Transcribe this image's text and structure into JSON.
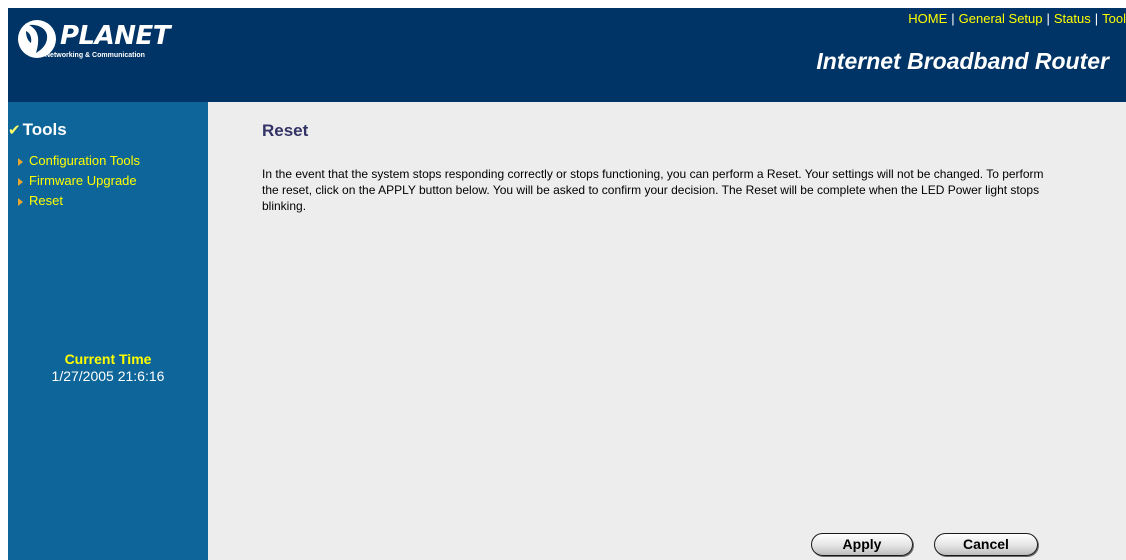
{
  "header": {
    "logo_text": "PLANET",
    "logo_tagline": "Networking & Communication",
    "nav": [
      "HOME",
      "General Setup",
      "Status",
      "Tool"
    ],
    "nav_separator": "|",
    "product_title": "Internet Broadband Router"
  },
  "sidebar": {
    "section_title": "Tools",
    "items": [
      {
        "label": "Configuration Tools"
      },
      {
        "label": "Firmware Upgrade"
      },
      {
        "label": "Reset"
      }
    ],
    "current_time_label": "Current Time",
    "current_time_value": "1/27/2005 21:6:16"
  },
  "main": {
    "title": "Reset",
    "description": "In the event that the system stops responding correctly or stops functioning, you can perform a Reset. Your settings will not be changed. To perform the reset, click on the APPLY button below. You will be asked to confirm your decision. The Reset will be complete when the LED Power light stops blinking.",
    "apply_label": "Apply",
    "cancel_label": "Cancel"
  },
  "colors": {
    "header_bg": "#003466",
    "sidebar_bg": "#0e6599",
    "content_bg": "#ededed",
    "link_yellow": "#ffff00",
    "title_text": "#333366"
  },
  "icons": [
    "planet-logo-icon",
    "checkmark-icon",
    "arrow-bullet-icon"
  ]
}
